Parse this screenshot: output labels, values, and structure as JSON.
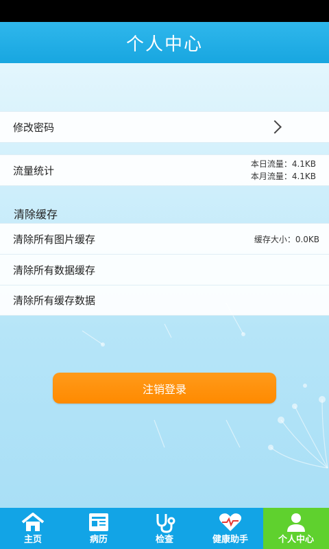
{
  "header": {
    "title": "个人中心"
  },
  "settings": {
    "change_password": "修改密码",
    "traffic_label": "流量统计",
    "traffic_today": "本日流量：4.1KB",
    "traffic_month": "本月流量：4.1KB"
  },
  "cache": {
    "section_title": "清除缓存",
    "clear_images": "清除所有图片缓存",
    "cache_size": "缓存大小：0.0KB",
    "clear_data": "清除所有数据缓存",
    "clear_all": "清除所有缓存数据"
  },
  "logout_label": "注销登录",
  "tabs": [
    {
      "label": "主页",
      "icon": "home-icon"
    },
    {
      "label": "病历",
      "icon": "medical-record-icon"
    },
    {
      "label": "检查",
      "icon": "stethoscope-icon"
    },
    {
      "label": "健康助手",
      "icon": "heart-pulse-icon"
    },
    {
      "label": "个人中心",
      "icon": "person-icon",
      "active": true
    }
  ],
  "colors": {
    "header": "#18a6e0",
    "tabbar": "#12a4e6",
    "active_tab": "#5fd12e",
    "logout_button": "#ff8a00"
  }
}
